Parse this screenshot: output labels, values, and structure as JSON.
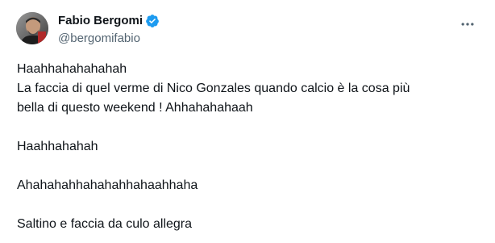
{
  "author": {
    "display_name": "Fabio Bergomi",
    "handle": "@bergomifabio",
    "verified": true,
    "verified_color": "#1d9bf0",
    "avatar_icon": "profile-photo"
  },
  "menu": {
    "more_icon": "more-horizontal-icon",
    "icon_color": "#536471"
  },
  "tweet": {
    "lines": [
      "Haahhahahahahah",
      "La faccia di quel verme di Nico Gonzales quando calcio è la cosa più",
      "bella di questo weekend ! Ahhahahahaah",
      "",
      "Haahhahahah",
      "",
      "Ahahahahhahahahhahaahhaha",
      "",
      "Saltino e faccia da culo allegra"
    ]
  },
  "colors": {
    "text_primary": "#0f1419",
    "text_secondary": "#536471",
    "background": "#ffffff"
  }
}
